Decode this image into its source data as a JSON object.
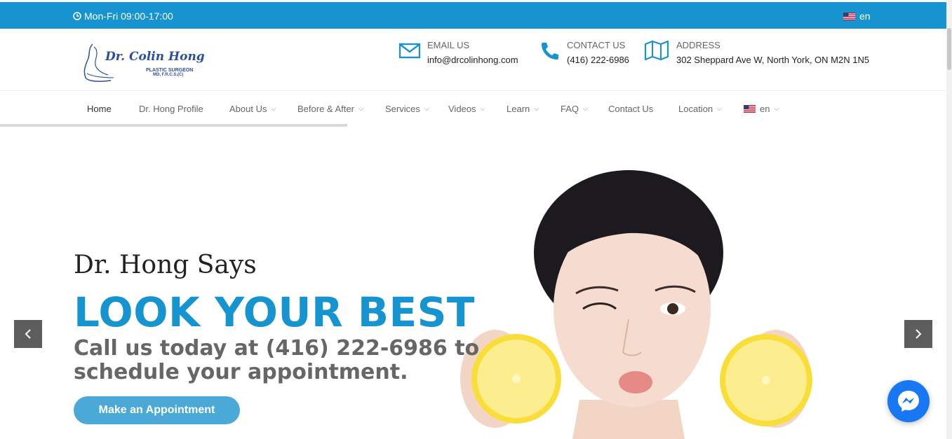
{
  "colors": {
    "accent": "#1594cf",
    "button": "#4aa9d6",
    "messenger": "#1877f2"
  },
  "topbar": {
    "hours": "Mon-Fri 09:00-17:00",
    "lang": "en",
    "hours_icon": "clock-icon",
    "lang_icon": "us-flag-icon"
  },
  "logo": {
    "name": "Dr. Colin Hong",
    "line1": "PLASTIC SURGEON",
    "line2": "MD, F.R.C.S.(C)"
  },
  "contacts": {
    "email": {
      "label": "EMAIL US",
      "value": "info@drcolinhong.com",
      "icon": "envelope-icon"
    },
    "phone": {
      "label": "CONTACT US",
      "value": "(416) 222-6986",
      "icon": "phone-icon"
    },
    "address": {
      "label": "ADDRESS",
      "value": "302 Sheppard Ave W, North York, ON M2N 1N5",
      "icon": "map-icon"
    }
  },
  "nav": {
    "items": [
      {
        "label": "Home"
      },
      {
        "label": "Dr. Hong Profile"
      },
      {
        "label": "About Us"
      },
      {
        "label": "Before & After"
      },
      {
        "label": "Services"
      },
      {
        "label": "Videos"
      },
      {
        "label": "Learn"
      },
      {
        "label": "FAQ"
      },
      {
        "label": "Contact Us"
      },
      {
        "label": "Location"
      },
      {
        "label": "en"
      }
    ]
  },
  "hero": {
    "eyebrow": "Dr. Hong Says",
    "headline": "LOOK YOUR BEST",
    "subline": "Call us today at (416) 222-6986 to schedule your appointment.",
    "cta": "Make an Appointment"
  }
}
